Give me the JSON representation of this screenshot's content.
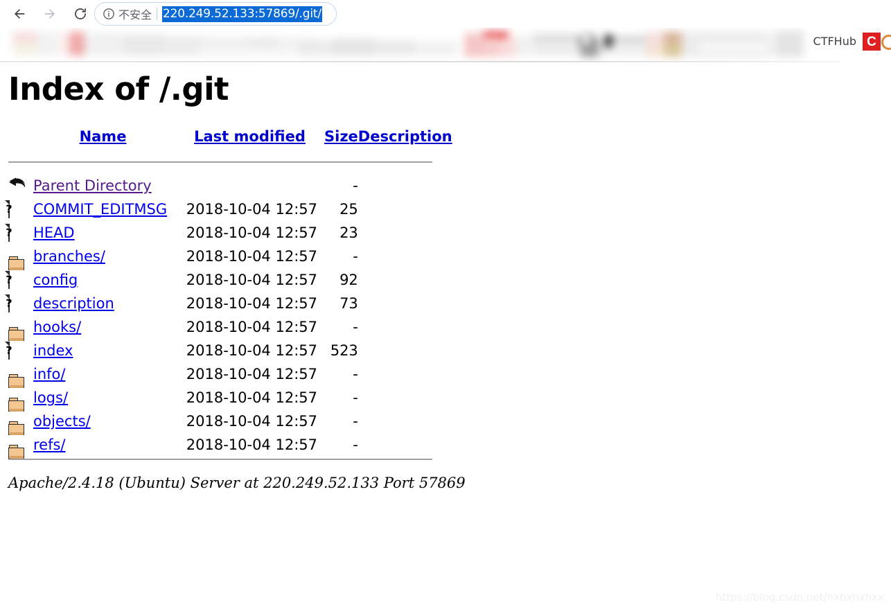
{
  "browser": {
    "back_label": "Back",
    "forward_label": "Forward",
    "reload_label": "Reload",
    "security_icon": "info-circle-icon",
    "security_text": "不安全",
    "url": "220.249.52.133:57869/.git/",
    "url_selected": true,
    "selection_color": "#0b6ad6"
  },
  "bookmarks": {
    "visible_label": "CTFHub",
    "favicon_letter": "C",
    "favicon_color": "#e02020",
    "note": "bookmark bar is blurred / censored"
  },
  "page": {
    "title": "Index of /.git",
    "columns": [
      "Name",
      "Last modified",
      "Size",
      "Description"
    ],
    "rows": [
      {
        "icon": "back-arrow-icon",
        "name": "Parent Directory",
        "visited": true,
        "modified": "",
        "size": "-",
        "description": ""
      },
      {
        "icon": "unknown-file-icon",
        "name": "COMMIT_EDITMSG",
        "visited": false,
        "modified": "2018-10-04 12:57",
        "size": "25",
        "description": ""
      },
      {
        "icon": "unknown-file-icon",
        "name": "HEAD",
        "visited": false,
        "modified": "2018-10-04 12:57",
        "size": "23",
        "description": ""
      },
      {
        "icon": "folder-icon",
        "name": "branches/",
        "visited": false,
        "modified": "2018-10-04 12:57",
        "size": "-",
        "description": ""
      },
      {
        "icon": "unknown-file-icon",
        "name": "config",
        "visited": false,
        "modified": "2018-10-04 12:57",
        "size": "92",
        "description": ""
      },
      {
        "icon": "unknown-file-icon",
        "name": "description",
        "visited": false,
        "modified": "2018-10-04 12:57",
        "size": "73",
        "description": ""
      },
      {
        "icon": "folder-icon",
        "name": "hooks/",
        "visited": false,
        "modified": "2018-10-04 12:57",
        "size": "-",
        "description": ""
      },
      {
        "icon": "unknown-file-icon",
        "name": "index",
        "visited": false,
        "modified": "2018-10-04 12:57",
        "size": "523",
        "description": ""
      },
      {
        "icon": "folder-icon",
        "name": "info/",
        "visited": false,
        "modified": "2018-10-04 12:57",
        "size": "-",
        "description": ""
      },
      {
        "icon": "folder-icon",
        "name": "logs/",
        "visited": false,
        "modified": "2018-10-04 12:57",
        "size": "-",
        "description": ""
      },
      {
        "icon": "folder-icon",
        "name": "objects/",
        "visited": false,
        "modified": "2018-10-04 12:57",
        "size": "-",
        "description": ""
      },
      {
        "icon": "folder-icon",
        "name": "refs/",
        "visited": false,
        "modified": "2018-10-04 12:57",
        "size": "-",
        "description": ""
      }
    ],
    "server_signature": "Apache/2.4.18 (Ubuntu) Server at 220.249.52.133 Port 57869"
  },
  "watermark": "https://blog.csdn.net/hxhxhxhxx"
}
